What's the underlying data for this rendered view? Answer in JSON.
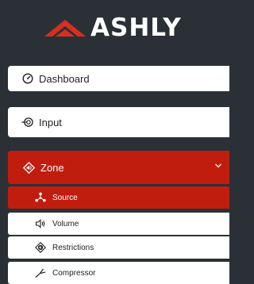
{
  "brand": {
    "name": "ASHLY",
    "accent": "#c11d0f"
  },
  "nav": {
    "dashboard": {
      "label": "Dashboard",
      "icon": "dashboard-gauge-icon"
    },
    "input": {
      "label": "Input",
      "icon": "input-plug-icon"
    },
    "zone": {
      "label": "Zone",
      "icon": "zone-speaker-icon",
      "expanded": true,
      "items": [
        {
          "label": "Source",
          "icon": "source-nodes-icon",
          "active": true
        },
        {
          "label": "Volume",
          "icon": "volume-speaker-icon",
          "active": false
        },
        {
          "label": "Restrictions",
          "icon": "restrictions-icon",
          "active": false
        },
        {
          "label": "Compressor",
          "icon": "compressor-icon",
          "active": false
        }
      ]
    }
  }
}
